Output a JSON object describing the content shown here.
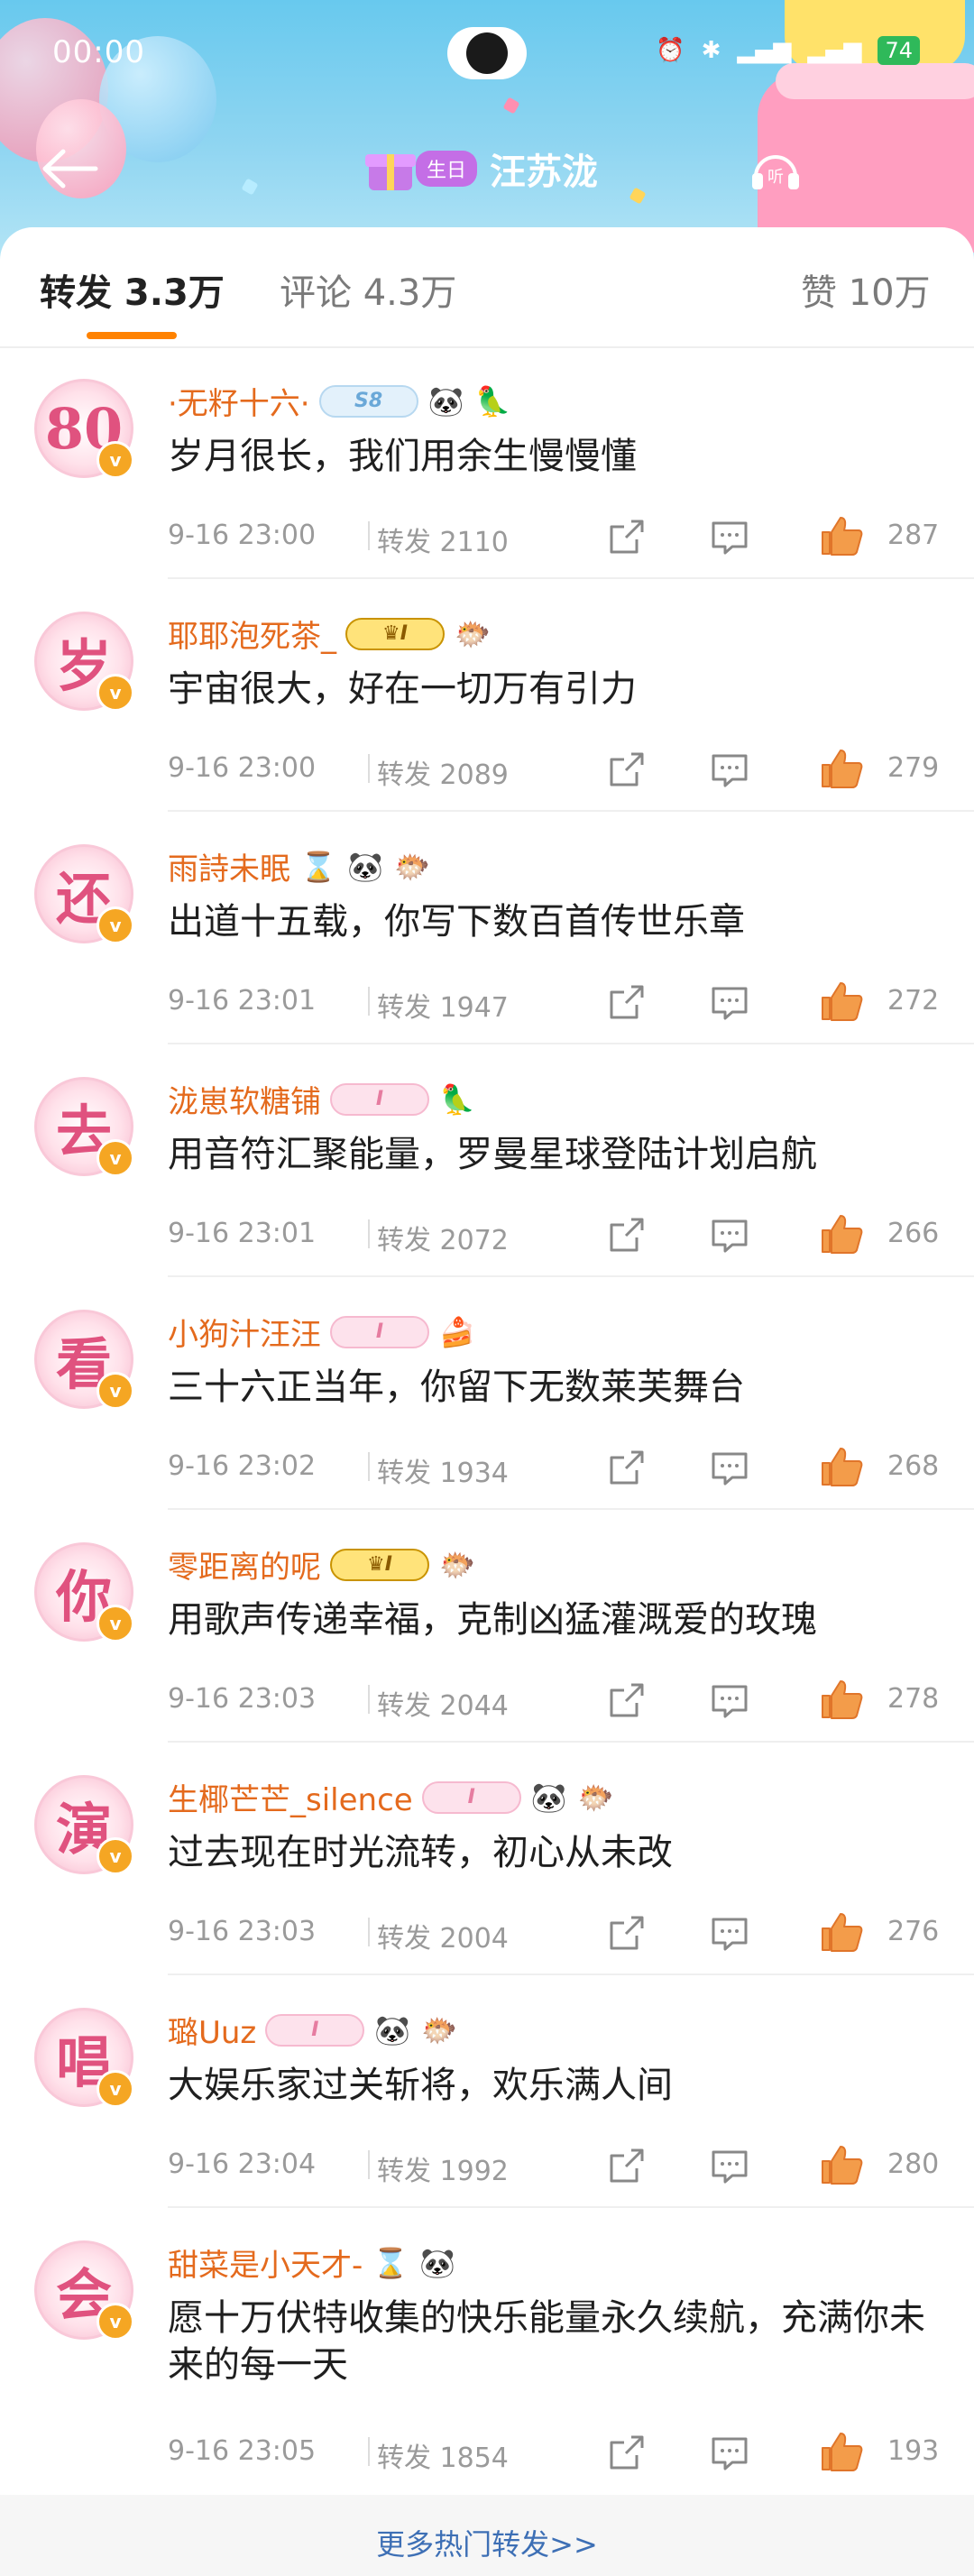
{
  "status": {
    "time": "00:00",
    "battery": "74"
  },
  "header": {
    "birthday_tag": "生日",
    "title": "汪苏泷",
    "listen": "听"
  },
  "tabs": {
    "repost": "转发 3.3万",
    "comment": "评论 4.3万",
    "like": "赞 10万"
  },
  "labels": {
    "repost_prefix": "转发"
  },
  "items": [
    {
      "avatar": "80",
      "user": "·无籽十六·",
      "badge": "S8",
      "text": "岁月很长，我们用余生慢慢懂",
      "time": "9-16 23:00",
      "reposts": "转发 2110",
      "likes": "287"
    },
    {
      "avatar": "岁",
      "user": "耶耶泡死茶_",
      "badge": "I",
      "text": "宇宙很大，好在一切万有引力",
      "time": "9-16 23:00",
      "reposts": "转发 2089",
      "likes": "279"
    },
    {
      "avatar": "还",
      "user": "雨詩未眠",
      "badge": "",
      "text": "出道十五载，你写下数百首传世乐章",
      "time": "9-16 23:01",
      "reposts": "转发 1947",
      "likes": "272"
    },
    {
      "avatar": "去",
      "user": "泷崽软糖铺",
      "badge": "I",
      "text": "用音符汇聚能量，罗曼星球登陆计划启航",
      "time": "9-16 23:01",
      "reposts": "转发 2072",
      "likes": "266"
    },
    {
      "avatar": "看",
      "user": "小狗汁汪汪",
      "badge": "I",
      "text": "三十六正当年，你留下无数莱芙舞台",
      "time": "9-16 23:02",
      "reposts": "转发 1934",
      "likes": "268"
    },
    {
      "avatar": "你",
      "user": "零距离的呢",
      "badge": "I",
      "text": "用歌声传递幸福，克制凶猛灌溉爱的玫瑰",
      "time": "9-16 23:03",
      "reposts": "转发 2044",
      "likes": "278"
    },
    {
      "avatar": "演",
      "user": "生椰芒芒_silence",
      "badge": "I",
      "text": "过去现在时光流转，初心从未改",
      "time": "9-16 23:03",
      "reposts": "转发 2004",
      "likes": "276"
    },
    {
      "avatar": "唱",
      "user": "璐Uuz",
      "badge": "I",
      "text": "大娱乐家过关斩将，欢乐满人间",
      "time": "9-16 23:04",
      "reposts": "转发 1992",
      "likes": "280"
    },
    {
      "avatar": "会",
      "user": "甜菜是小天才-",
      "badge": "",
      "text": "愿十万伏特收集的快乐能量永久续航，充满你未来的每一天",
      "time": "9-16 23:05",
      "reposts": "转发 1854",
      "likes": "193"
    }
  ],
  "footer": {
    "more": "更多热门转发>>"
  },
  "colors": {
    "accent": "#ff8200",
    "username": "#e46a1d",
    "link": "#3d6fb5"
  }
}
